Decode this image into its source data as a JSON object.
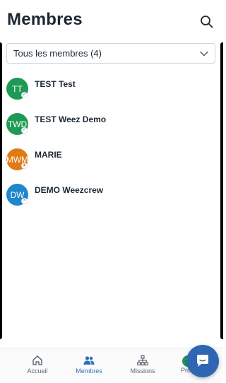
{
  "header": {
    "title": "Membres"
  },
  "filter": {
    "selected": "Tous les membres (4)"
  },
  "members": [
    {
      "initials": "TT",
      "name": "TEST Test",
      "color": "#1f9a55",
      "status": "confirmed",
      "status_glyph": "✓",
      "status_color": "#1f9a55"
    },
    {
      "initials": "TWD",
      "name": "TEST Weez Demo",
      "color": "#1f9a55",
      "status": "confirmed",
      "status_glyph": "✓",
      "status_color": "#1f9a55"
    },
    {
      "initials": "MWM",
      "name": "MARIE",
      "color": "#e07a14",
      "status": "pending",
      "status_glyph": "⧗",
      "status_color": "#e07a14"
    },
    {
      "initials": "DW",
      "name": "DEMO Weezcrew",
      "color": "#1f86cc",
      "status": "declined",
      "status_glyph": "×",
      "status_color": "#d64545"
    }
  ],
  "nav": {
    "accueil": "Accueil",
    "membres": "Membres",
    "missions": "Missions",
    "profil": "Pro",
    "profil_initials": "T",
    "active": "membres"
  },
  "colors": {
    "accent": "#2f6fb8",
    "fab": "#2f66b2"
  },
  "icons": [
    "search-icon",
    "chevron-down-icon",
    "home-icon",
    "users-icon",
    "sitemap-icon",
    "chat-icon"
  ]
}
